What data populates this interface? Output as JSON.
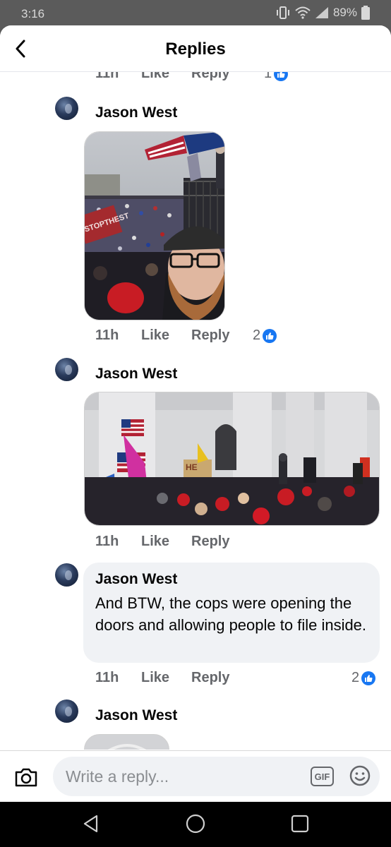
{
  "status_bar": {
    "time": "3:16",
    "battery": "89%"
  },
  "header": {
    "title": "Replies"
  },
  "partial_comment": {
    "time": "11h",
    "like": "Like",
    "reply": "Reply",
    "reactions": "1"
  },
  "comments": [
    {
      "author": "Jason West",
      "time": "11h",
      "like": "Like",
      "reply": "Reply",
      "reactions": "2"
    },
    {
      "author": "Jason West",
      "time": "11h",
      "like": "Like",
      "reply": "Reply"
    },
    {
      "author": "Jason West",
      "text": "And BTW, the cops were opening the doors and allowing people to file inside.",
      "time": "11h",
      "like": "Like",
      "reply": "Reply",
      "reactions": "2"
    },
    {
      "author": "Jason West"
    }
  ],
  "photo1": {
    "sign_text": "STOPTHEST"
  },
  "photo2": {
    "sign_text": "HE"
  },
  "composer": {
    "placeholder": "Write a reply...",
    "gif_label": "GIF"
  },
  "icons": [
    "back-arrow-icon",
    "like-icon",
    "camera-icon",
    "emoji-icon",
    "nav-back-icon",
    "nav-home-icon",
    "nav-recents-icon"
  ]
}
